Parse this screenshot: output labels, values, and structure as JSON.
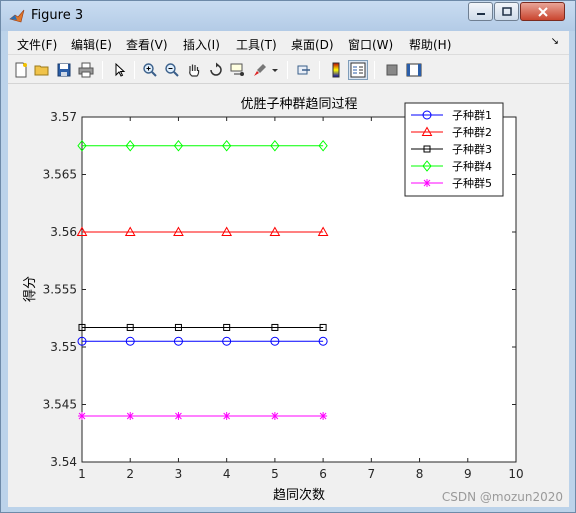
{
  "window": {
    "title": "Figure 3"
  },
  "menu": [
    {
      "label": "文件(F)"
    },
    {
      "label": "编辑(E)"
    },
    {
      "label": "查看(V)"
    },
    {
      "label": "插入(I)"
    },
    {
      "label": "工具(T)"
    },
    {
      "label": "桌面(D)"
    },
    {
      "label": "窗口(W)"
    },
    {
      "label": "帮助(H)"
    }
  ],
  "toolbar_icons": [
    "new-figure-icon",
    "open-file-icon",
    "save-icon",
    "print-icon",
    "edit-plot-arrow-icon",
    "zoom-in-icon",
    "zoom-out-icon",
    "pan-hand-icon",
    "rotate-3d-icon",
    "data-cursor-icon",
    "brush-icon",
    "link-plot-icon",
    "colorbar-icon",
    "legend-icon",
    "hide-plot-tools-icon",
    "show-plot-tools-icon"
  ],
  "watermark": "CSDN @mozun2020",
  "chart_data": {
    "type": "line",
    "title": "优胜子种群趋同过程",
    "xlabel": "趋同次数",
    "ylabel": "得分",
    "xlim": [
      1,
      10
    ],
    "ylim": [
      3.54,
      3.57
    ],
    "xticks": [
      "1",
      "2",
      "3",
      "4",
      "5",
      "6",
      "7",
      "8",
      "9",
      "10"
    ],
    "yticks": [
      "3.54",
      "3.545",
      "3.55",
      "3.555",
      "3.56",
      "3.565",
      "3.57"
    ],
    "grid": false,
    "legend_position": "top-right",
    "x": [
      1,
      2,
      3,
      4,
      5,
      6
    ],
    "series": [
      {
        "name": "子种群1",
        "color": "#0000ff",
        "marker": "circle",
        "values": [
          3.5505,
          3.5505,
          3.5505,
          3.5505,
          3.5505,
          3.5505
        ]
      },
      {
        "name": "子种群2",
        "color": "#ff0000",
        "marker": "triangle",
        "values": [
          3.56,
          3.56,
          3.56,
          3.56,
          3.56,
          3.56
        ]
      },
      {
        "name": "子种群3",
        "color": "#000000",
        "marker": "square",
        "values": [
          3.5517,
          3.5517,
          3.5517,
          3.5517,
          3.5517,
          3.5517
        ]
      },
      {
        "name": "子种群4",
        "color": "#00ff00",
        "marker": "diamond",
        "values": [
          3.5675,
          3.5675,
          3.5675,
          3.5675,
          3.5675,
          3.5675
        ]
      },
      {
        "name": "子种群5",
        "color": "#ff00ff",
        "marker": "star",
        "values": [
          3.544,
          3.544,
          3.544,
          3.544,
          3.544,
          3.544
        ]
      }
    ]
  }
}
